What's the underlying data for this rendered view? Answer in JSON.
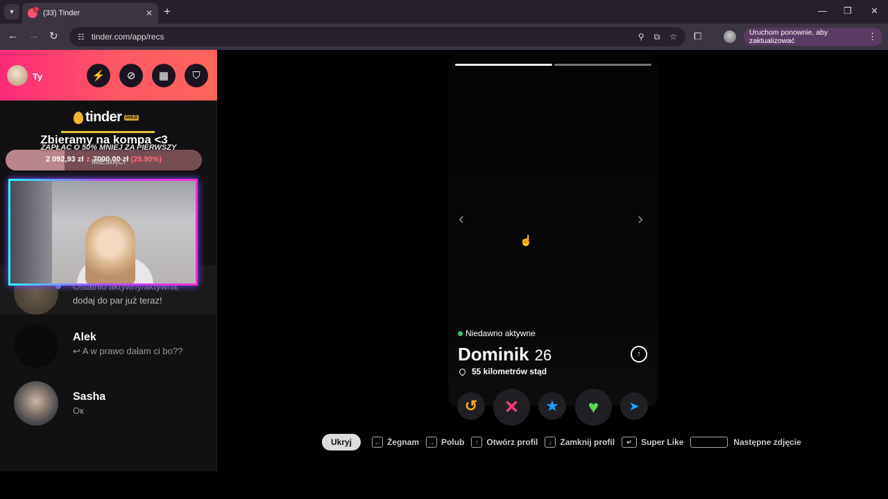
{
  "browser": {
    "tab_title": "(33) Tinder",
    "url": "tinder.com/app/recs",
    "update_label": "Uruchom ponownie, aby zaktualizować"
  },
  "sidebar": {
    "user_name": "Ty",
    "logo_text": "tinder",
    "gold_badge": "GOLD",
    "goal_title": "Zbieramy na kompa <3",
    "promo_line1": "ZAPŁAĆ O 50% MNIEJ ZA PIERWSZY",
    "promo_line2": "MIESIĄC!",
    "goal_current": "2 092,93 zł",
    "goal_sep": "z",
    "goal_target": "7000,00 zł",
    "goal_percent_label": "(29.90%)",
    "goal_fraction": 0.299,
    "overlay_msg1": "Ostatnio aktywny/aktywna,",
    "overlay_msg2": "dodaj do par już teraz!",
    "matches": [
      {
        "name": "Alek",
        "message": "↩ A w prawo dałam ci bo??"
      },
      {
        "name": "Sasha",
        "message": "Ок"
      }
    ]
  },
  "card": {
    "activity": "Niedawno aktywne",
    "name": "Dominik",
    "age": "26",
    "distance": "55 kilometrów stąd",
    "photo_count": 2,
    "current_photo": 1
  },
  "shortcuts": {
    "hide": "Ukryj",
    "items": [
      "Żegnam",
      "Polub",
      "Otwórz profil",
      "Zamknij profil",
      "Super Like",
      "Następne zdjęcie"
    ]
  },
  "colors": {
    "brand_gradient_start": "#fd297b",
    "brand_gradient_end": "#ff655b",
    "rewind": "#f5a623",
    "nope": "#fe3c72",
    "superlike": "#1ca4fc",
    "like": "#5cd35c",
    "boost": "#21a0ff"
  }
}
